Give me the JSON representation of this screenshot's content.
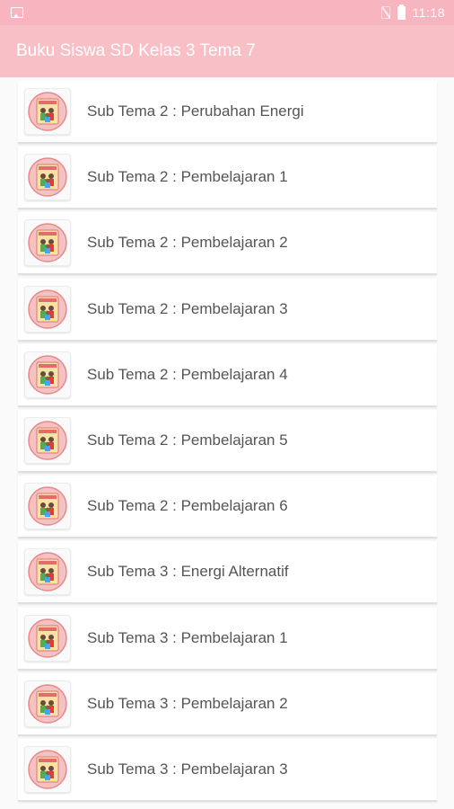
{
  "status_bar": {
    "time": "11:18"
  },
  "app_bar": {
    "title": "Buku Siswa SD Kelas 3 Tema 7"
  },
  "list": {
    "items": [
      {
        "label": "Sub Tema 2 : Perubahan Energi"
      },
      {
        "label": "Sub Tema 2 : Pembelajaran 1"
      },
      {
        "label": "Sub Tema 2 : Pembelajaran 2"
      },
      {
        "label": "Sub Tema 2 : Pembelajaran 3"
      },
      {
        "label": "Sub Tema 2 : Pembelajaran 4"
      },
      {
        "label": "Sub Tema 2 : Pembelajaran 5"
      },
      {
        "label": "Sub Tema 2 : Pembelajaran 6"
      },
      {
        "label": "Sub Tema 3 : Energi Alternatif"
      },
      {
        "label": "Sub Tema 3 : Pembelajaran 1"
      },
      {
        "label": "Sub Tema 3 : Pembelajaran 2"
      },
      {
        "label": "Sub Tema 3 : Pembelajaran 3"
      }
    ]
  },
  "colors": {
    "status_bar": "#f7b5bf",
    "app_bar": "#f9bfc6",
    "text": "#555555",
    "background": "#fafafa"
  }
}
